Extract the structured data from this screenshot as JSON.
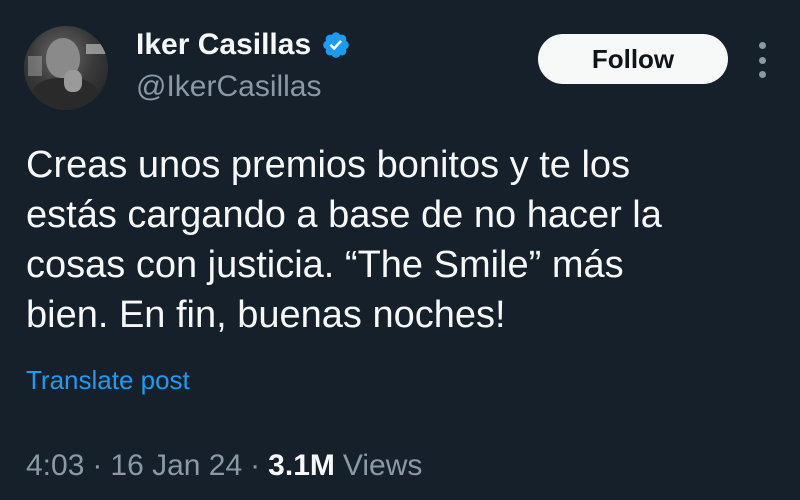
{
  "author": {
    "display_name": "Iker Casillas",
    "handle": "@IkerCasillas",
    "verified": true,
    "verified_color": "#1d9bf0"
  },
  "follow_label": "Follow",
  "tweet": {
    "text_lines": [
      "Creas unos premios bonitos y te los",
      "estás cargando a base de no hacer la",
      "cosas con justicia. “The Smile” más",
      "bien. En fin, buenas noches!"
    ],
    "translate_label": "Translate post",
    "time": "4:03",
    "date": "16 Jan 24",
    "separator": "·",
    "views_count": "3.1M",
    "views_label": "Views"
  },
  "colors": {
    "background": "#15202b",
    "text": "#f7f9f9",
    "secondary_text": "#8b98a5",
    "link": "#1d9bf0"
  },
  "icons": {
    "verified": "verified-badge-icon",
    "more": "more-options-icon"
  }
}
